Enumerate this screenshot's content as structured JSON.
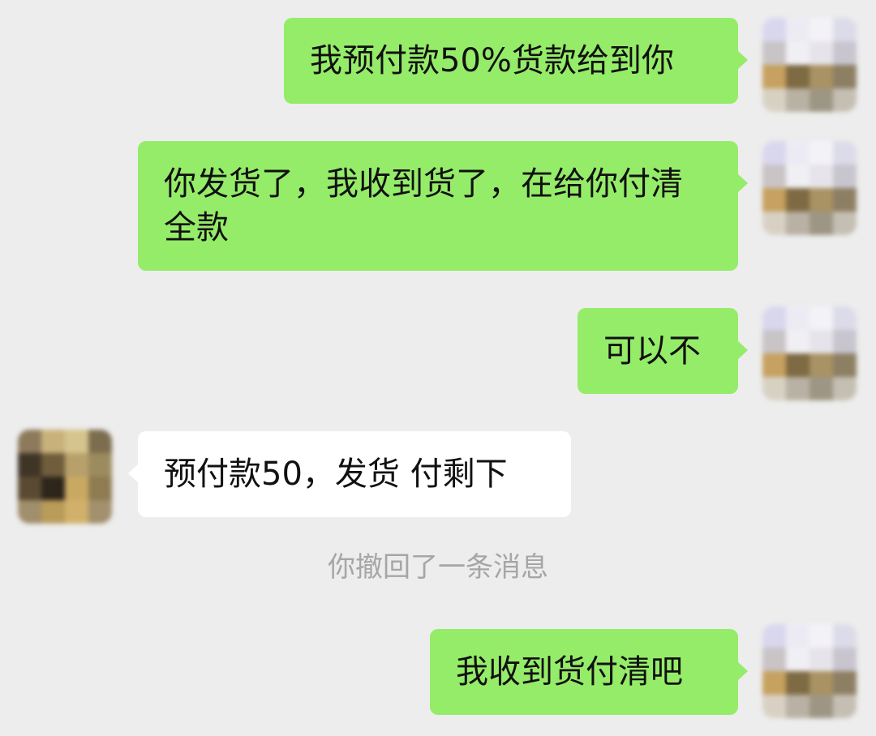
{
  "messages": [
    {
      "text": "我预付款50%货款给到你"
    },
    {
      "text": "你发货了，我收到货了，在给你付清全款"
    },
    {
      "text": "可以不"
    },
    {
      "text": "预付款50，发货 付剩下"
    },
    {
      "text": "我收到货付清吧"
    }
  ],
  "system_notice": "你撤回了一条消息",
  "colors": {
    "background": "#ededed",
    "outgoing_bubble": "#95ec69",
    "incoming_bubble": "#ffffff",
    "notice_text": "#a6a6a6"
  },
  "icons": {
    "self_avatar": "pixelated-avatar-icon",
    "contact_avatar": "pixelated-avatar-icon"
  }
}
